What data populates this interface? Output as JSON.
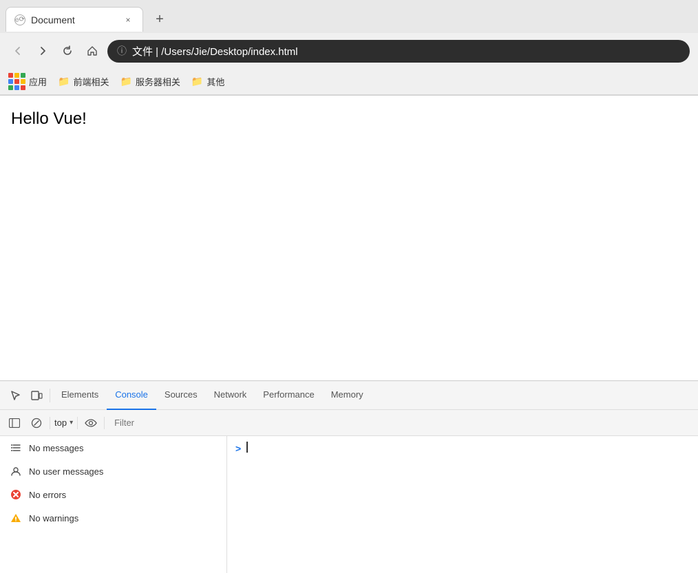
{
  "browser": {
    "tab": {
      "favicon_alt": "globe-icon",
      "title": "Document",
      "close_label": "×"
    },
    "new_tab_label": "+",
    "nav": {
      "back_label": "‹",
      "forward_label": "›",
      "reload_label": "↻",
      "home_label": "⌂"
    },
    "address": {
      "info_icon": "ⓘ",
      "text": "文件  |  /Users/Jie/Desktop/index.html"
    },
    "bookmarks": [
      {
        "id": "apps",
        "label": "应用"
      },
      {
        "id": "frontend",
        "label": "前端相关"
      },
      {
        "id": "server",
        "label": "服务器相关"
      },
      {
        "id": "other",
        "label": "其他"
      }
    ]
  },
  "page": {
    "content": "Hello Vue!"
  },
  "devtools": {
    "tabs": [
      {
        "id": "elements",
        "label": "Elements",
        "active": false
      },
      {
        "id": "console",
        "label": "Console",
        "active": true
      },
      {
        "id": "sources",
        "label": "Sources",
        "active": false
      },
      {
        "id": "network",
        "label": "Network",
        "active": false
      },
      {
        "id": "performance",
        "label": "Performance",
        "active": false
      },
      {
        "id": "memory",
        "label": "Memory",
        "active": false
      }
    ],
    "toolbar": {
      "context": "top",
      "filter_placeholder": "Filter"
    },
    "sidebar": {
      "items": [
        {
          "id": "no-messages",
          "icon": "list",
          "label": "No messages"
        },
        {
          "id": "no-user-messages",
          "icon": "user",
          "label": "No user messages"
        },
        {
          "id": "no-errors",
          "icon": "error",
          "label": "No errors"
        },
        {
          "id": "no-warnings",
          "icon": "warning",
          "label": "No warnings"
        }
      ]
    },
    "console": {
      "prompt": ">"
    }
  }
}
